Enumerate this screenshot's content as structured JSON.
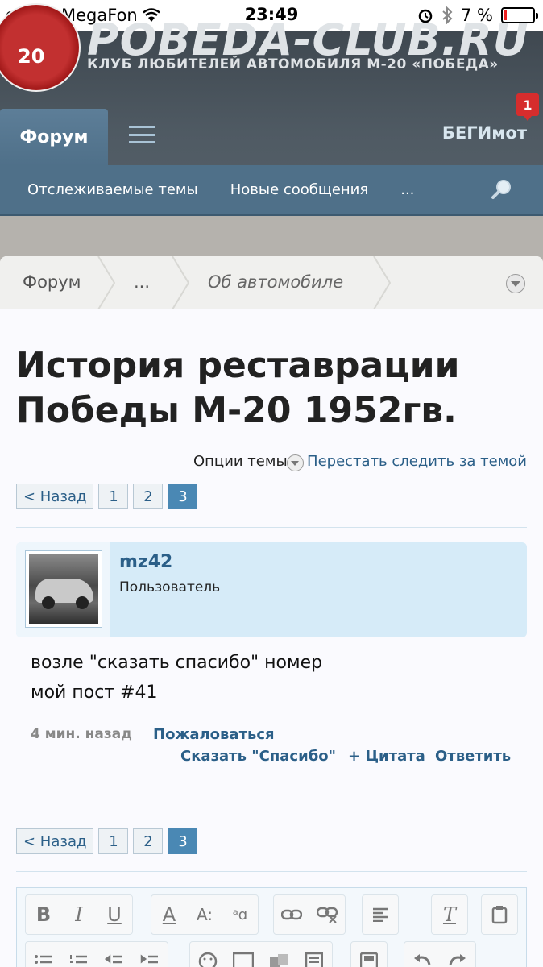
{
  "status_bar": {
    "carrier": "MegaFon",
    "time": "23:49",
    "battery_text": "7 %",
    "battery_level": 0.07
  },
  "site": {
    "logo_text": "20",
    "name": "POBEDA-CLUB.RU",
    "slogan": "КЛУБ ЛЮБИТЕЛЕЙ АВТОМОБИЛЯ М-20 «ПОБЕДА»"
  },
  "nav": {
    "forum_tab": "Форум",
    "user_name": "БЕГИмот",
    "notification_count": "1"
  },
  "subnav": {
    "watched": "Отслеживаемые темы",
    "new_posts": "Новые сообщения",
    "more": "..."
  },
  "breadcrumb": {
    "forum": "Форум",
    "ellipsis": "...",
    "section": "Об автомобиле"
  },
  "thread": {
    "title": "История реставрации Победы М-20 1952гв.",
    "options_label": "Опции темы",
    "unwatch_label": "Перестать следить за темой"
  },
  "pager": {
    "back": "< Назад",
    "pages": [
      "1",
      "2",
      "3"
    ],
    "current": "3"
  },
  "post": {
    "username": "mz42",
    "role": "Пользователь",
    "body_line1": "возле \"сказать спасибо\" номер",
    "body_line2": "мой пост #41",
    "time": "4 мин. назад",
    "report": "Пожаловаться",
    "thanks": "Сказать \"Спасибо\"",
    "quote": "+ Цитата",
    "reply": "Ответить"
  },
  "colors": {
    "link": "#2b5f88",
    "nav_blue": "#4f7089",
    "header_dark": "#3f4850",
    "current_page": "#4a88b4",
    "badge_red": "#d62d2d"
  }
}
